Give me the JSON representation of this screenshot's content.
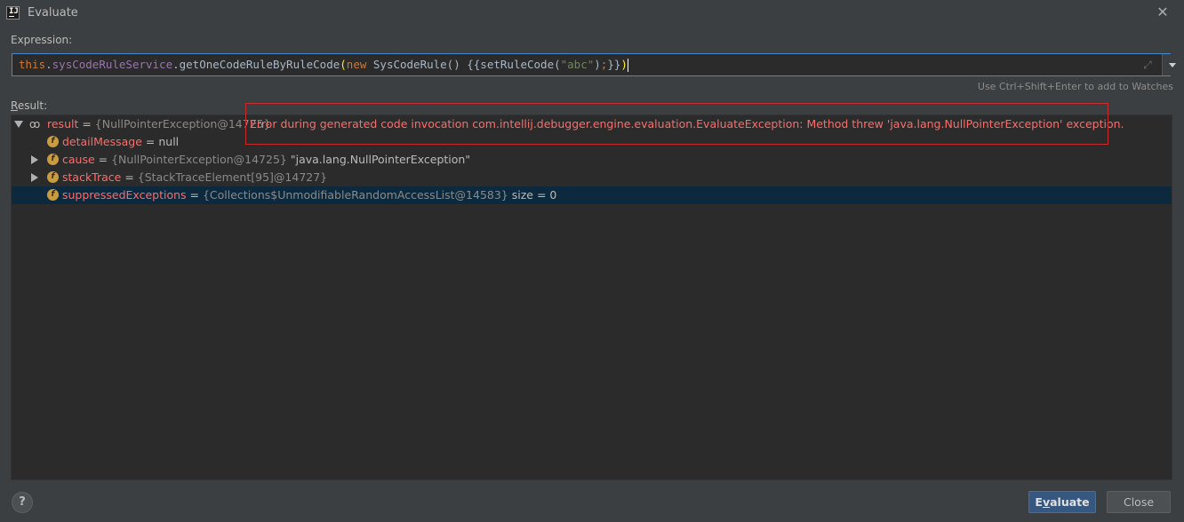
{
  "window": {
    "title": "Evaluate",
    "app_icon_label": "IJ"
  },
  "expression": {
    "label": "Expression:",
    "tokens": {
      "this": "this",
      "dot1": ".",
      "field": "sysCodeRuleService",
      "method": ".getOneCodeRuleByRuleCode",
      "open_paren": "(",
      "new": "new",
      "ctor": " SysCodeRule() {{setRuleCode(",
      "string": "\"abc\"",
      "close_call": ")",
      "semicolon": ";",
      "close_braces": "}}",
      "close_paren": ")"
    },
    "hint": "Use Ctrl+Shift+Enter to add to Watches"
  },
  "result": {
    "label_prefix": "R",
    "label_rest": "esult:",
    "rows": [
      {
        "name": "result",
        "eq": " = ",
        "type": "{NullPointerException@14725}",
        "error": "Error during generated code invocation com.intellij.debugger.engine.evaluation.EvaluateException: Method threw 'java.lang.NullPointerException' exception."
      },
      {
        "name": "detailMessage",
        "eq": " = ",
        "value": "null"
      },
      {
        "name": "cause",
        "eq": " = ",
        "type": "{NullPointerException@14725}",
        "value": " \"java.lang.NullPointerException\""
      },
      {
        "name": "stackTrace",
        "eq": " = ",
        "type": "{StackTraceElement[95]@14727}"
      },
      {
        "name": "suppressedExceptions",
        "eq": " = ",
        "type": "{Collections$UnmodifiableRandomAccessList@14583}",
        "value": "  size = 0"
      }
    ]
  },
  "buttons": {
    "help": "?",
    "evaluate_prefix": "E",
    "evaluate_mnemonic": "v",
    "evaluate_rest": "aluate",
    "close": "Close"
  },
  "icons": {
    "close": "close-icon",
    "expand": "expand-icon",
    "dropdown": "chevron-down-icon",
    "watch": "glasses-icon",
    "field": "field-icon"
  },
  "colors": {
    "background": "#3c3f41",
    "editor_bg": "#2b2b2b",
    "focus_border": "#4a88c7",
    "error": "#ff6b68",
    "error_border": "#c72b2b",
    "selection": "#0d293e",
    "keyword": "#cc7832",
    "field": "#9876aa",
    "string": "#6a8759",
    "primary_button": "#365880"
  }
}
